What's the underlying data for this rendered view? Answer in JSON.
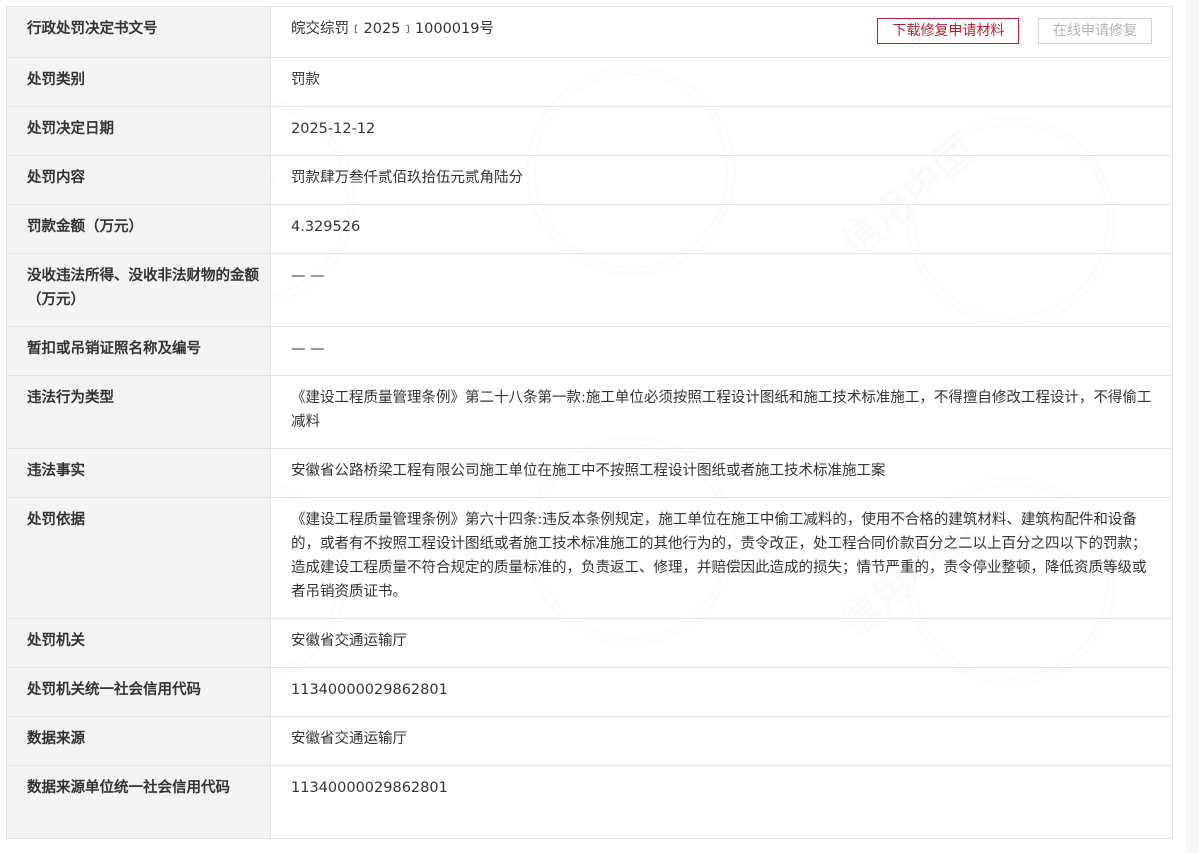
{
  "actions": {
    "download_label": "下载修复申请材料",
    "online_label": "在线申请修复"
  },
  "watermark": {
    "text": "信用中国"
  },
  "rows": [
    {
      "label": "行政处罚决定书文号",
      "value": "皖交综罚﹝2025﹞1000019号"
    },
    {
      "label": "处罚类别",
      "value": "罚款"
    },
    {
      "label": "处罚决定日期",
      "value": "2025-12-12"
    },
    {
      "label": "处罚内容",
      "value": "罚款肆万叁仟贰佰玖拾伍元贰角陆分"
    },
    {
      "label": "罚款金额（万元）",
      "value": "4.329526"
    },
    {
      "label": "没收违法所得、没收非法财物的金额（万元）",
      "value": "— —"
    },
    {
      "label": "暂扣或吊销证照名称及编号",
      "value": "— —"
    },
    {
      "label": "违法行为类型",
      "value": "《建设工程质量管理条例》第二十八条第一款:施工单位必须按照工程设计图纸和施工技术标准施工，不得擅自修改工程设计，不得偷工减料"
    },
    {
      "label": "违法事实",
      "value": "安徽省公路桥梁工程有限公司施工单位在施工中不按照工程设计图纸或者施工技术标准施工案"
    },
    {
      "label": "处罚依据",
      "value": "《建设工程质量管理条例》第六十四条:违反本条例规定，施工单位在施工中偷工减料的，使用不合格的建筑材料、建筑构配件和设备的，或者有不按照工程设计图纸或者施工技术标准施工的其他行为的，责令改正，处工程合同价款百分之二以上百分之四以下的罚款；造成建设工程质量不符合规定的质量标准的，负责返工、修理，并赔偿因此造成的损失；情节严重的，责令停业整顿，降低资质等级或者吊销资质证书。"
    },
    {
      "label": "处罚机关",
      "value": "安徽省交通运输厅"
    },
    {
      "label": "处罚机关统一社会信用代码",
      "value": "11340000029862801"
    },
    {
      "label": "数据来源",
      "value": "安徽省交通运输厅"
    },
    {
      "label": "数据来源单位统一社会信用代码",
      "value": "11340000029862801"
    }
  ]
}
